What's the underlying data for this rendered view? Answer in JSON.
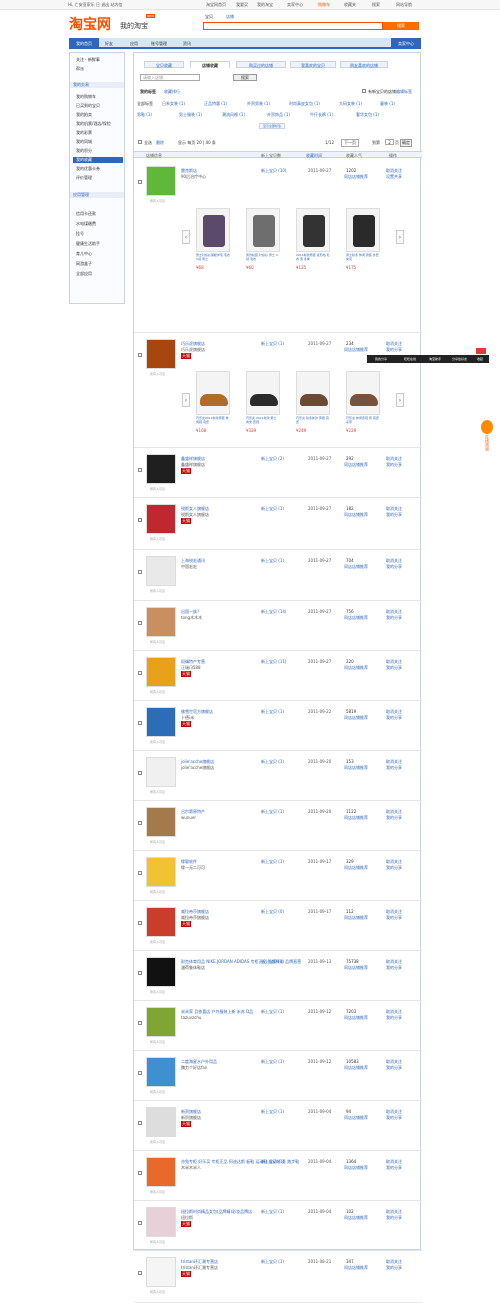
{
  "topbar": {
    "greeting": "Hi, 亡安亚家乐 日  退出  站内信",
    "links": [
      "淘宝网首页",
      "我要买",
      "我的淘宝",
      "卖家中心",
      "购物车",
      "收藏夹",
      "搜索",
      "网站导航"
    ]
  },
  "header": {
    "logo": "淘宝网",
    "subtitle": "我的淘宝",
    "new_badge": "NEW",
    "search_tabs": [
      "宝贝",
      "店铺"
    ],
    "search_placeholder": "",
    "search_button": "搜索"
  },
  "nav": {
    "home": "我的首页",
    "items": [
      "好友",
      "应用",
      "账号管理",
      "资讯"
    ],
    "account": "卖家中心"
  },
  "sidebar": {
    "sections": [
      {
        "title": "我的交易",
        "items": [
          "我的购物车",
          "已买到的宝贝",
          "我的拍卖",
          "我的机票/酒店/保险",
          "我的彩票",
          "我的同城",
          "我的积分",
          "我的收藏",
          "我的优惠卡券",
          "评价管理"
        ]
      },
      {
        "title": "应用管理",
        "items": [
          "信用卡还款",
          "水电煤缴费",
          "挂号",
          "健康生活助手",
          "育儿中心",
          "网游盒子",
          "全部应用"
        ]
      }
    ],
    "top_items": [
      "关注 · 新鲜事",
      "帮派"
    ],
    "selected": "我的收藏"
  },
  "page_tabs": [
    "宝贝收藏",
    "店铺收藏",
    "购买过的店铺",
    "我喜欢的宝贝",
    "朋友喜欢的店铺"
  ],
  "sub_tabs": [
    "我的标签",
    "收藏排行"
  ],
  "search": {
    "placeholder": "请输入店铺",
    "button": "搜索"
  },
  "filter": {
    "new_only": "有新宝贝的店铺",
    "edit": "编辑标签"
  },
  "tags": [
    "全部标签",
    "日系女装 (1)",
    "正品特惠 (1)",
    "外贸男装 (1)",
    "时尚真皮女包 (1)",
    "大码女装 (1)",
    "童装 (1)",
    "男鞋 (1)",
    "男士服装 (1)",
    "潮流风格 (1)",
    "外贸饰品 (1)",
    "牛仔长裤 (1)",
    "奢华女包 (1)",
    "显示全部标签"
  ],
  "list_controls": {
    "select_all": "全选",
    "delete": "删除",
    "count": "显示  每页 20 | 40 条",
    "page": "1/12",
    "next": "下一页",
    "goto": "到第",
    "goto_val": "2",
    "goto_unit": "页",
    "goto_btn": "确定"
  },
  "table_headers": [
    "店铺信息",
    "新上宝贝数",
    "收藏时间",
    "收藏人气",
    "操作"
  ],
  "shops": [
    {
      "name": "雷克斯店",
      "owner": "90后治疗中心",
      "badge": "",
      "new": "新上宝贝 (10)",
      "date": "2011-09-27",
      "pop": "1202",
      "same": "同店店铺推荐",
      "a1": "取消关注",
      "a2": "设置共享"
    },
    {
      "name": "巧乐虎旗舰店",
      "owner": "巧乐虎旗舰店",
      "badge": "天猫",
      "new": "新上宝贝 (1)",
      "date": "2011-09-27",
      "pop": "234",
      "same": "同店店铺推荐",
      "a1": "取消关注",
      "a2": "我的分享"
    },
    {
      "name": "鑫盛祥旗舰店",
      "owner": "鑫盛祥旗舰店",
      "badge": "天猫",
      "new": "新上宝贝 (2)",
      "date": "2011-09-27",
      "pop": "292",
      "same": "同店店铺推荐",
      "a1": "取消关注",
      "a2": "我的分享"
    },
    {
      "name": "锐斯女人旗舰店",
      "owner": "锐斯女人旗舰店",
      "badge": "天猫",
      "new": "新上宝贝 (1)",
      "date": "2011-09-27",
      "pop": "182",
      "same": "同店店铺推荐",
      "a1": "取消关注",
      "a2": "我的分享"
    },
    {
      "name": "上海锐宏通讯",
      "owner": "中国宏宏",
      "badge": "",
      "new": "新上宝贝 (1)",
      "date": "2011-09-27",
      "pop": "704",
      "same": "同店店铺推荐",
      "a1": "取消关注",
      "a2": "我的分享"
    },
    {
      "name": "出国一族？",
      "owner": "tong木木木",
      "badge": "",
      "new": "新上宝贝 (14)",
      "date": "2011-09-27",
      "pop": "756",
      "same": "同店店铺推荐",
      "a1": "取消关注",
      "a2": "我的分享"
    },
    {
      "name": "斑斓特产专营",
      "owner": "正瑞/3588",
      "badge": "天猫",
      "new": "新上宝贝 (11)",
      "date": "2011-09-27",
      "pop": "220",
      "same": "同店店铺推荐",
      "a1": "取消关注",
      "a2": "我的分享"
    },
    {
      "name": "佛雪世官方旗舰店",
      "owner": "卜德ⅰ米",
      "badge": "天猫",
      "new": "新上宝贝 (1)",
      "date": "2011-09-22",
      "pop": "5819",
      "same": "同店店铺推荐",
      "a1": "取消关注",
      "a2": "我的分享"
    },
    {
      "name": "jolie'acche旗舰店",
      "owner": "jolie'acche旗舰店",
      "badge": "",
      "new": "新上宝贝 (1)",
      "date": "2011-09-20",
      "pop": "153",
      "same": "同店店铺推荐",
      "a1": "取消关注",
      "a2": "我的分享"
    },
    {
      "name": "吕尔第原特产",
      "owner": "wunuer",
      "badge": "",
      "new": "新上宝贝 (1)",
      "date": "2011-09-20",
      "pop": "1122",
      "same": "同店店铺推荐",
      "a1": "取消关注",
      "a2": "我的分享"
    },
    {
      "name": "缘聪软件",
      "owner": "缘一无二可可",
      "badge": "",
      "new": "新上宝贝 (1)",
      "date": "2011-09-17",
      "pop": "329",
      "same": "同店店铺推荐",
      "a1": "取消关注",
      "a2": "我的分享"
    },
    {
      "name": "威拉帝莎旗舰店",
      "owner": "威拉帝莎旗舰店",
      "badge": "天猫",
      "new": "新上宝贝 (0)",
      "date": "2011-09-17",
      "pop": "112",
      "same": "同店店铺推荐",
      "a1": "取消关注",
      "a2": "我的分享"
    },
    {
      "name": "耐克体育用品 NIKE JORDAN ADIDAS 专柜正品 防爆降价 品牌直营",
      "owner": "潘荷鲁体鞋店",
      "badge": "",
      "new": "新上宝贝 (1)",
      "date": "2011-09-13",
      "pop": "75738",
      "same": "同店店铺推荐",
      "a1": "取消关注",
      "a2": "我的分享"
    },
    {
      "name": "米米家 且依喜店 户外服装上新 米苏 D品",
      "owner": "tazuvzchu",
      "badge": "",
      "new": "新上宝贝 (1)",
      "date": "2011-09-12",
      "pop": "7203",
      "same": "同店店铺推荐",
      "a1": "取消关注",
      "a2": "我的分享"
    },
    {
      "name": "二度海星水户外用品",
      "owner": "魏力个好店fan",
      "badge": "",
      "new": "新上宝贝 (1)",
      "date": "2011-09-12",
      "pop": "10583",
      "same": "同店店铺推荐",
      "a1": "取消关注",
      "a2": "我的分享"
    },
    {
      "name": "新贸旗舰店",
      "owner": "新贸旗舰店",
      "badge": "天猫",
      "new": "新上宝贝 (1)",
      "date": "2011-09-04",
      "pop": "94",
      "same": "同店店铺推荐",
      "a1": "取消关注",
      "a2": "我的分享"
    },
    {
      "name": "亦兔专柜 好乐买 专柜正品 阿迪达斯 板鞋 运动鞋 运动装 夏 跑步鞋",
      "owner": "木米木米人",
      "badge": "",
      "new": "新上宝贝 (1)",
      "date": "2011-09-04",
      "pop": "1364",
      "same": "同店店铺推荐",
      "a1": "取消关注",
      "a2": "我的分享"
    },
    {
      "name": "纽拉斯时尚精品女包(品牌精)彩妆品牌店",
      "owner": "纽拉斯",
      "badge": "天猫",
      "new": "新上宝贝 (1)",
      "date": "2011-09-04",
      "pop": "102",
      "same": "同店店铺推荐",
      "a1": "取消关注",
      "a2": "我的分享"
    },
    {
      "name": "tristan环汇潮专营店",
      "owner": "tristan环汇潮专营店",
      "badge": "天猫",
      "new": "新上宝贝 (1)",
      "date": "2011-08-21",
      "pop": "347",
      "same": "同店店铺推荐",
      "a1": "取消关注",
      "a2": "我的分享"
    }
  ],
  "avatar_label": "所有人可见",
  "products_row1": [
    {
      "desc": "男士针织衫保暖羊毛 毛衣 V领 男士",
      "price": "¥68"
    },
    {
      "desc": "男款秋装 针织衫 男士 V领 毛衣",
      "price": "¥60"
    },
    {
      "desc": "2011新款男装 菱形格 毛衣 男 冬季",
      "price": "¥125"
    },
    {
      "desc": "男士秋冬 休闲 男装 外套 夹克",
      "price": "¥175"
    }
  ],
  "products_row2": [
    {
      "desc": "巧乐虎2011新款男鞋 休闲鞋 真皮",
      "price": "¥168"
    },
    {
      "desc": "巧乐虎 2011新款 男士 商务 皮鞋",
      "price": "¥329"
    },
    {
      "desc": "巧乐虎 秋冬新款 男鞋 真皮",
      "price": "¥249"
    },
    {
      "desc": "巧乐虎 休闲皮鞋 男 真皮 系带",
      "price": "¥229"
    }
  ],
  "floatbar": {
    "items": [
      "我的分享",
      "旺旺在线",
      "淘宝助手",
      "分享给好友",
      "收起"
    ]
  },
  "mascot_text": "在线咨询",
  "colors": {
    "brand": "#ff5000",
    "nav_blue": "#2d66bc",
    "link": "#2d66bc"
  }
}
